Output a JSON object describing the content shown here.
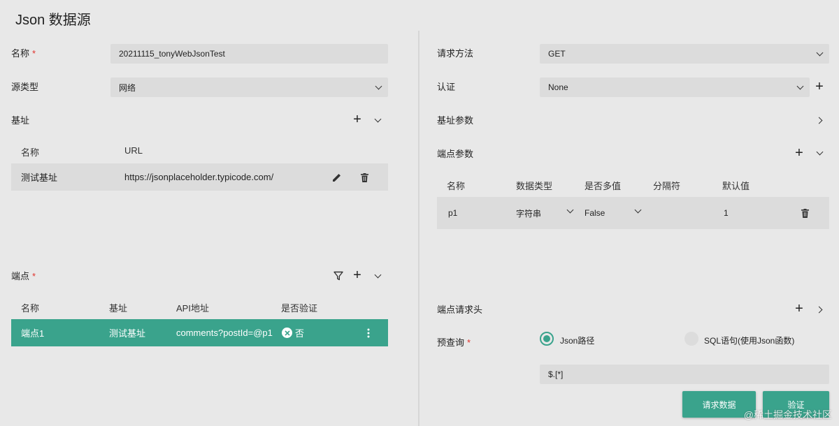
{
  "page": {
    "title": "Json 数据源"
  },
  "left": {
    "name_label": "名称",
    "name_value": "20211115_tonyWebJsonTest",
    "source_type_label": "源类型",
    "source_type_value": "网络",
    "base_label": "基址",
    "base_table": {
      "headers": [
        "名称",
        "URL"
      ],
      "rows": [
        {
          "name": "测试基址",
          "url": "https://jsonplaceholder.typicode.com/"
        }
      ]
    },
    "endpoint_label": "端点",
    "endpoint_table": {
      "headers": [
        "名称",
        "基址",
        "API地址",
        "是否验证"
      ],
      "rows": [
        {
          "name": "端点1",
          "base": "测试基址",
          "api": "comments?postId=@p1",
          "verify": "否"
        }
      ]
    }
  },
  "right": {
    "method_label": "请求方法",
    "method_value": "GET",
    "auth_label": "认证",
    "auth_value": "None",
    "base_params_label": "基址参数",
    "endpoint_params_label": "端点参数",
    "params_table": {
      "headers": [
        "名称",
        "数据类型",
        "是否多值",
        "分隔符",
        "默认值"
      ],
      "rows": [
        {
          "name": "p1",
          "type": "字符串",
          "multi": "False",
          "separator": "",
          "default": "1"
        }
      ]
    },
    "endpoint_headers_label": "端点请求头",
    "prequery_label": "预查询",
    "radio_json": "Json路径",
    "radio_sql": "SQL语句(使用Json函数)",
    "path_value": "$.[*]",
    "btn_request": "请求数据",
    "btn_verify": "验证"
  },
  "watermark": "@稀土掘金技术社区",
  "colors": {
    "accent": "#3aa38c",
    "required": "#e0322c",
    "field_bg": "#dcdcdc",
    "page_bg": "#e8e8e8"
  }
}
